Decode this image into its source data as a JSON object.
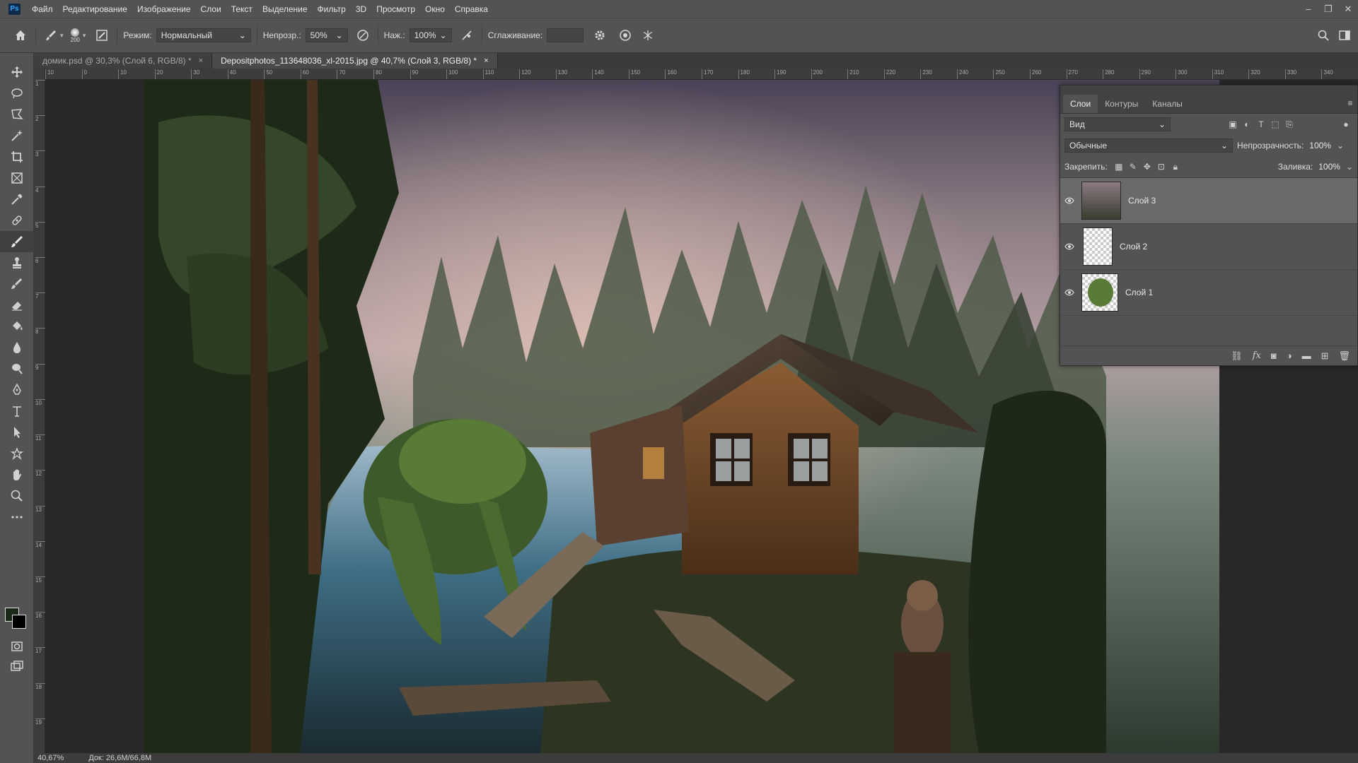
{
  "app": {
    "logo": "Ps"
  },
  "menu": [
    "Файл",
    "Редактирование",
    "Изображение",
    "Слои",
    "Текст",
    "Выделение",
    "Фильтр",
    "3D",
    "Просмотр",
    "Окно",
    "Справка"
  ],
  "window_controls": {
    "minimize": "–",
    "restore": "❐",
    "close": "✕"
  },
  "options": {
    "brush_size": "200",
    "mode_label": "Режим:",
    "mode_value": "Нормальный",
    "opacity_label": "Непрозр.:",
    "opacity_value": "50%",
    "pressure_label": "Наж.:",
    "pressure_value": "100%",
    "smoothing_label": "Сглаживание:",
    "smoothing_value": ""
  },
  "tabs": [
    {
      "label": "домик.psd @ 30,3% (Слой 6, RGB/8) *",
      "close": "×"
    },
    {
      "label": "Depositphotos_113648036_xl-2015.jpg @ 40,7% (Слой 3, RGB/8) *",
      "close": "×"
    }
  ],
  "ruler_h": [
    "10",
    "0",
    "10",
    "20",
    "30",
    "40",
    "50",
    "60",
    "70",
    "80",
    "90",
    "100",
    "110",
    "120",
    "130",
    "140",
    "150",
    "160",
    "170",
    "180",
    "190",
    "200",
    "210",
    "220",
    "230",
    "240",
    "250",
    "260",
    "270",
    "280",
    "290",
    "300",
    "310",
    "320",
    "330",
    "340"
  ],
  "ruler_v": [
    "1",
    "2",
    "3",
    "4",
    "5",
    "6",
    "7",
    "8",
    "9",
    "10",
    "11",
    "12",
    "13",
    "14",
    "15",
    "16",
    "17",
    "18",
    "19"
  ],
  "layers_panel": {
    "tabs": [
      "Слои",
      "Контуры",
      "Каналы"
    ],
    "filter_value": "Вид",
    "blend_value": "Обычные",
    "opacity_label": "Непрозрачность:",
    "opacity_value": "100%",
    "lock_label": "Закрепить:",
    "fill_label": "Заливка:",
    "fill_value": "100%",
    "layers": [
      {
        "name": "Слой 3",
        "visible": true,
        "selected": true
      },
      {
        "name": "Слой 2",
        "visible": true,
        "selected": false
      },
      {
        "name": "Слой 1",
        "visible": true,
        "selected": false
      }
    ]
  },
  "status": {
    "zoom": "40,67%",
    "doc": "Док: 26,6M/66,8M"
  }
}
